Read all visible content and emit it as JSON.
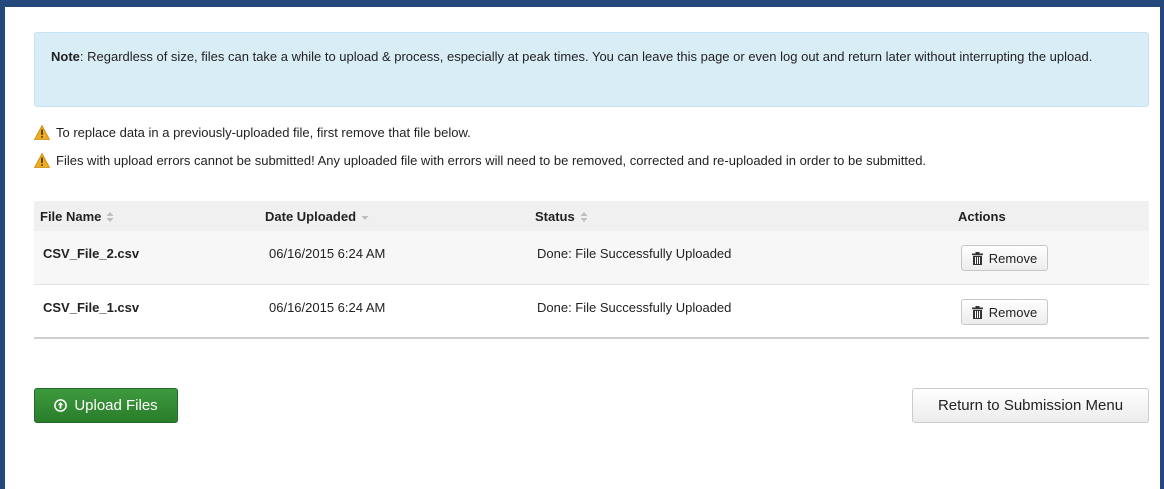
{
  "note": {
    "label": "Note",
    "text": ": Regardless of size, files can take a while to upload & process, especially at peak times. You can leave this page or even log out and return later without interrupting the upload."
  },
  "warnings": [
    "To replace data in a previously-uploaded file, first remove that file below.",
    "Files with upload errors cannot be submitted! Any uploaded file with errors will need to be removed, corrected and re-uploaded in order to be submitted."
  ],
  "table": {
    "headers": {
      "file_name": "File Name",
      "date_uploaded": "Date Uploaded",
      "status": "Status",
      "actions": "Actions"
    },
    "rows": [
      {
        "file_name": "CSV_File_2.csv",
        "date_uploaded": "06/16/2015 6:24 AM",
        "status": "Done: File Successfully Uploaded",
        "action_label": "Remove"
      },
      {
        "file_name": "CSV_File_1.csv",
        "date_uploaded": "06/16/2015 6:24 AM",
        "status": "Done: File Successfully Uploaded",
        "action_label": "Remove"
      }
    ]
  },
  "buttons": {
    "upload_label": "Upload Files",
    "return_label": "Return to Submission Menu"
  },
  "colors": {
    "frame": "#24487b",
    "note_bg": "#d9edf7",
    "upload_green": "#2f872f",
    "warning_yellow": "#f0ad1e"
  },
  "icons": {
    "warning": "warning-icon",
    "sort": "sort-icon",
    "sort_desc": "sort-desc-icon",
    "trash": "trash-icon",
    "upload": "upload-icon"
  }
}
